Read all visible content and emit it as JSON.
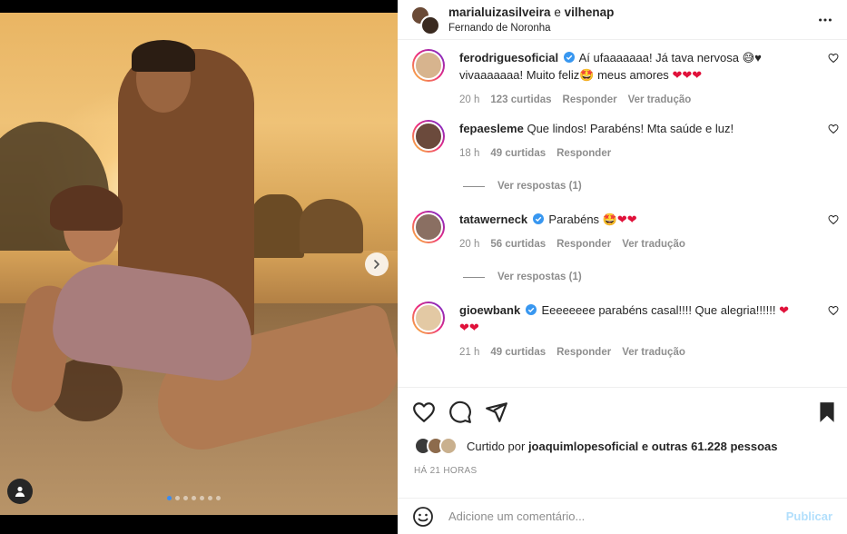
{
  "header": {
    "user1": "marialuizasilveira",
    "connector": "e",
    "user2": "vilhenap",
    "location": "Fernando de Noronha"
  },
  "comments": [
    {
      "username": "ferodriguesoficial",
      "verified": true,
      "text_line1": "Aí ufaaaaaaa! Já tava nervosa",
      "emoji_line1": "😅♥",
      "text_line2": "vivaaaaaaa! Muito feliz",
      "emoji_line2": "🤩",
      "text_line2b": "meus amores",
      "hearts": "❤❤❤",
      "time": "20 h",
      "likes": "123 curtidas",
      "reply": "Responder",
      "translate": "Ver tradução"
    },
    {
      "username": "fepaesleme",
      "verified": false,
      "text_line1": "Que lindos! Parabéns! Mta saúde e luz!",
      "time": "18 h",
      "likes": "49 curtidas",
      "reply": "Responder",
      "view_replies": "Ver respostas (1)"
    },
    {
      "username": "tatawerneck",
      "verified": true,
      "text_line1": "Parabéns",
      "emoji_line1": "🤩",
      "hearts": "❤❤",
      "time": "20 h",
      "likes": "56 curtidas",
      "reply": "Responder",
      "translate": "Ver tradução",
      "view_replies": "Ver respostas (1)"
    },
    {
      "username": "gioewbank",
      "verified": true,
      "text_line1": "Eeeeeeee parabéns casal!!!! Que alegria!!!!!!",
      "hearts_line1": "❤",
      "hearts_line2": "❤❤",
      "time": "21 h",
      "likes": "49 curtidas",
      "reply": "Responder",
      "translate": "Ver tradução"
    }
  ],
  "likes_summary": {
    "prefix": "Curtido por",
    "user": "joaquimlopesoficial",
    "suffix": "e outras 61.228 pessoas"
  },
  "post_time": "HÁ 21 HORAS",
  "comment_box": {
    "placeholder": "Adicione um comentário...",
    "publish": "Publicar"
  },
  "carousel": {
    "slide_count": 7,
    "active_index": 0
  },
  "colors": {
    "accent_blue": "#0095f6",
    "verified_blue": "#3897f0",
    "heart_red": "#e0113a",
    "muted_text": "#8e8e8e"
  },
  "icons": [
    "chevron-right-icon",
    "user-tag-icon",
    "more-options-icon",
    "verified-badge-icon",
    "heart-icon",
    "comment-icon",
    "share-icon",
    "bookmark-icon",
    "emoji-icon"
  ]
}
